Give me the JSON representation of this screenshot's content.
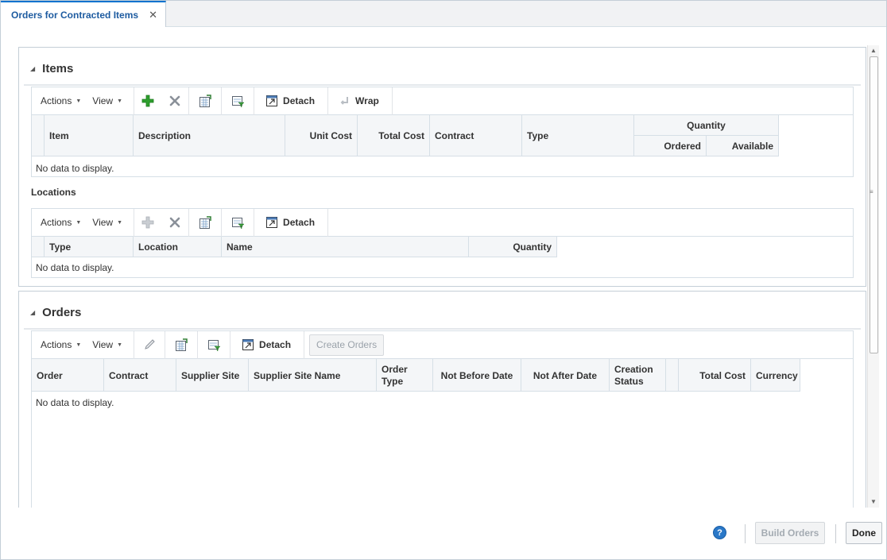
{
  "tab": {
    "label": "Orders for Contracted Items",
    "close": "✕"
  },
  "items": {
    "title": "Items",
    "toolbar": {
      "actions": "Actions",
      "view": "View",
      "detach": "Detach",
      "wrap": "Wrap"
    },
    "quantity_group": "Quantity",
    "columns": [
      "Item",
      "Description",
      "Unit Cost",
      "Total Cost",
      "Contract",
      "Type",
      "Ordered",
      "Available"
    ],
    "empty": "No data to display."
  },
  "locations": {
    "title": "Locations",
    "toolbar": {
      "actions": "Actions",
      "view": "View",
      "detach": "Detach"
    },
    "columns": [
      "Type",
      "Location",
      "Name",
      "Quantity"
    ],
    "empty": "No data to display."
  },
  "orders": {
    "title": "Orders",
    "toolbar": {
      "actions": "Actions",
      "view": "View",
      "detach": "Detach",
      "create_orders": "Create Orders"
    },
    "columns": [
      "Order",
      "Contract",
      "Supplier Site",
      "Supplier Site Name",
      "Order Type",
      "Not Before Date",
      "Not After Date",
      "Creation Status",
      "",
      "Total Cost",
      "Currency"
    ],
    "empty": "No data to display."
  },
  "footer": {
    "help": "?",
    "build_orders": "Build Orders",
    "done": "Done"
  },
  "colors": {
    "accent": "#0572ce",
    "add_icon": "#2e9e2e",
    "help_icon": "#2a78c8"
  }
}
